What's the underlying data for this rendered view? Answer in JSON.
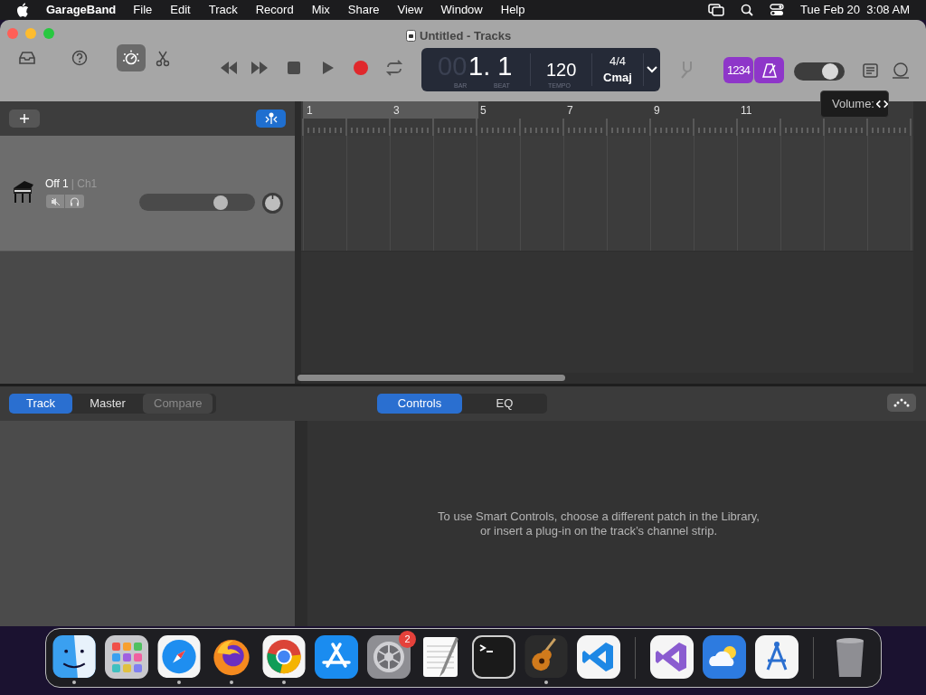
{
  "menu_bar": {
    "app": "GarageBand",
    "menus": [
      "File",
      "Edit",
      "Track",
      "Record",
      "Mix",
      "Share",
      "View",
      "Window",
      "Help"
    ],
    "clock": "Tue Feb 20  3:08 AM"
  },
  "window": {
    "title": "Untitled - Tracks"
  },
  "toolbar": {
    "tools": [
      {
        "kind": "library",
        "selected": false
      },
      {
        "kind": "help",
        "selected": false
      },
      {
        "kind": "smart_controls",
        "selected": true
      },
      {
        "kind": "editors",
        "selected": false
      }
    ],
    "transport": [
      {
        "kind": "rewind"
      },
      {
        "kind": "forward"
      },
      {
        "kind": "stop"
      },
      {
        "kind": "play"
      },
      {
        "kind": "record"
      },
      {
        "kind": "cycle"
      }
    ],
    "lcd": {
      "bar_prefix": "00",
      "position": "1. 1",
      "bar_label": "BAR",
      "beat_label": "BEAT",
      "tempo": "120",
      "tempo_label": "TEMPO",
      "signature": "4/4",
      "key": "Cmaj"
    },
    "count_in": {
      "label": "1234",
      "on": true
    },
    "metronome": {
      "on": true
    },
    "volume": {
      "level": 0.82
    },
    "tooltip": "Volume:"
  },
  "tracks": [
    {
      "name": "Off 1",
      "channel": "| Ch1",
      "muted": false,
      "soloed": false,
      "volume": {
        "level": 0.74
      }
    }
  ],
  "ruler": [
    "1",
    "3",
    "5",
    "7",
    "9",
    "11"
  ],
  "smart_controls": {
    "view_tabs": [
      {
        "label": "Track",
        "selected": true,
        "disabled": false
      },
      {
        "label": "Master",
        "selected": false,
        "disabled": false
      },
      {
        "label": "Compare",
        "selected": false,
        "disabled": true
      }
    ],
    "mode_tabs": [
      {
        "label": "Controls",
        "selected": true
      },
      {
        "label": "EQ",
        "selected": false
      }
    ],
    "message": "To use Smart Controls, choose a different patch in the Library,\nor insert a plug-in on the track’s channel strip."
  },
  "dock": [
    {
      "kind": "finder",
      "running": true
    },
    {
      "kind": "launchpad",
      "running": false
    },
    {
      "kind": "safari",
      "running": true
    },
    {
      "kind": "firefox",
      "running": true
    },
    {
      "kind": "chrome",
      "running": true
    },
    {
      "kind": "appstore",
      "running": false
    },
    {
      "kind": "settings",
      "running": false,
      "badge": "2"
    },
    {
      "kind": "textedit",
      "running": false
    },
    {
      "kind": "terminal",
      "running": false
    },
    {
      "kind": "garageband",
      "running": true
    },
    {
      "kind": "vscode",
      "running": false
    },
    {
      "kind": "separator"
    },
    {
      "kind": "visualstudio",
      "running": false
    },
    {
      "kind": "weather",
      "running": false
    },
    {
      "kind": "instruments",
      "running": false
    },
    {
      "kind": "separator"
    },
    {
      "kind": "trash",
      "running": false
    }
  ]
}
